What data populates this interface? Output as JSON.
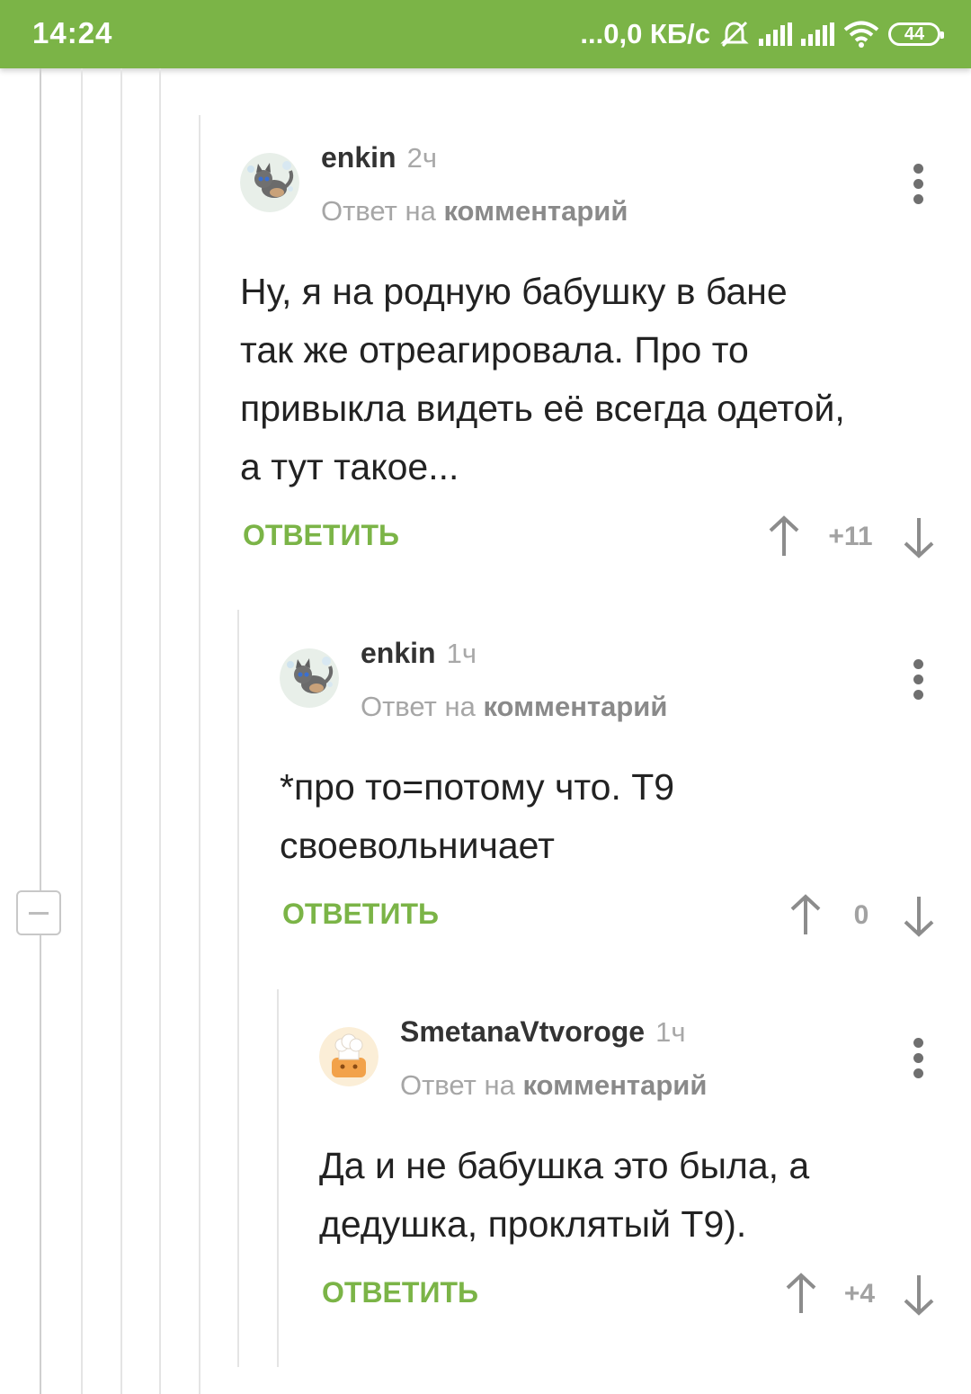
{
  "status_bar": {
    "time": "14:24",
    "network_speed": "...0,0 КБ/с",
    "battery_level": "44"
  },
  "comments": [
    {
      "author": "enkin",
      "time": "2ч",
      "reply_prefix": "Ответ на",
      "reply_link": "комментарий",
      "text_lines": [
        "Ну, я на родную бабушку в бане",
        "так же отреагировала. Про то",
        "привыкла видеть её всегда одетой,",
        "а тут такое..."
      ],
      "reply_label": "ОТВЕТИТЬ",
      "score": "+11"
    },
    {
      "author": "enkin",
      "time": "1ч",
      "reply_prefix": "Ответ на",
      "reply_link": "комментарий",
      "text_lines": [
        "*про то=потому что. Т9",
        "своевольничает"
      ],
      "reply_label": "ОТВЕТИТЬ",
      "score": "0"
    },
    {
      "author": "SmetanaVtvoroge",
      "time": "1ч",
      "reply_prefix": "Ответ на",
      "reply_link": "комментарий",
      "text_lines": [
        "Да и не бабушка это была, а",
        "дедушка, проклятый Т9)."
      ],
      "reply_label": "ОТВЕТИТЬ",
      "score": "+4"
    }
  ],
  "colors": {
    "accent": "#7bb447",
    "text": "#222222",
    "muted": "#a6a6a6"
  }
}
